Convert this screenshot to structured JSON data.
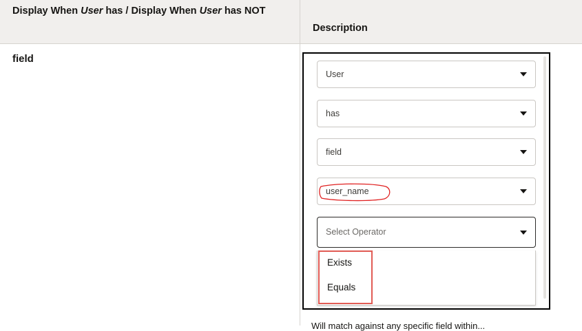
{
  "table": {
    "header_left_parts": [
      "Display When ",
      "User",
      " has / Display When ",
      "User",
      " has NOT"
    ],
    "header_right": "Description",
    "row_label": "field"
  },
  "screenshot": {
    "dropdowns": [
      {
        "value": "User"
      },
      {
        "value": "has"
      },
      {
        "value": "field"
      },
      {
        "value": "user_name"
      }
    ],
    "operator_placeholder": "Select Operator",
    "options": [
      "Exists",
      "Equals"
    ],
    "icons": {
      "dropdown": "chevron-down-icon",
      "annotation": "red-circle-annotation"
    },
    "colors": {
      "annotation": "#e02020",
      "highlight": "#e15b54"
    }
  },
  "description_fragment": "Will match against any specific field within..."
}
